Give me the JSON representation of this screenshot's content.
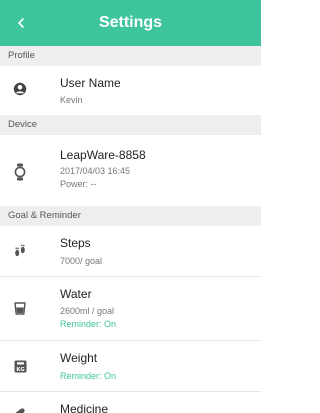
{
  "header": {
    "back_glyph": "<",
    "title": "Settings",
    "background": "#3fc59e"
  },
  "sections": {
    "profile": "Profile",
    "device": "Device",
    "goal": "Goal & Reminder"
  },
  "profile": {
    "icon": "user-circle-icon",
    "label": "User Name",
    "value": "Kevin"
  },
  "device": {
    "icon": "watch-icon",
    "name": "LeapWare-8858",
    "date": "2017/04/03 16:45",
    "power": "Power: --"
  },
  "goals": {
    "steps": {
      "icon": "footsteps-icon",
      "label": "Steps",
      "goal": "7000/ goal"
    },
    "water": {
      "icon": "cup-icon",
      "label": "Water",
      "goal": "2600ml / goal",
      "reminder": "Reminder: On"
    },
    "weight": {
      "icon": "scale-kg-icon",
      "label": "Weight",
      "reminder": "Reminder: On"
    },
    "medicine": {
      "icon": "pill-icon",
      "label": "Medicine"
    }
  },
  "colors": {
    "accent": "#3fc59e",
    "section_bg": "#eeeeee"
  }
}
